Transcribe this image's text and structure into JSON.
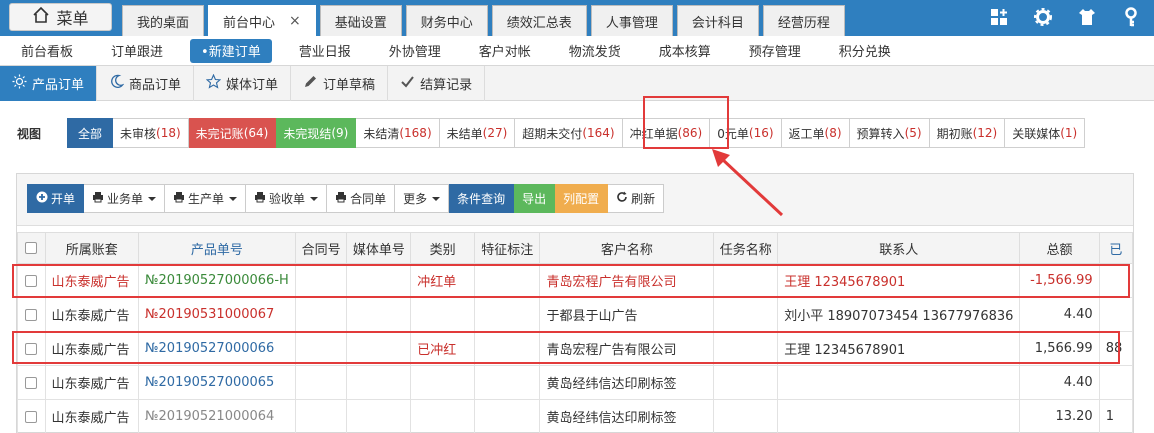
{
  "topbar": {
    "menu_label": "菜单",
    "tabs": [
      {
        "label": "我的桌面"
      },
      {
        "label": "前台中心",
        "close": "×"
      },
      {
        "label": "基础设置"
      },
      {
        "label": "财务中心"
      },
      {
        "label": "绩效汇总表"
      },
      {
        "label": "人事管理"
      },
      {
        "label": "会计科目"
      },
      {
        "label": "经营历程"
      }
    ]
  },
  "subnav": [
    "前台看板",
    "订单跟进",
    "•新建订单",
    "营业日报",
    "外协管理",
    "客户对帐",
    "物流发货",
    "成本核算",
    "预存管理",
    "积分兑换"
  ],
  "order_tabs": [
    "产品订单",
    "商品订单",
    "媒体订单",
    "订单草稿",
    "结算记录"
  ],
  "view": {
    "label": "视图",
    "filters": [
      {
        "label": "全部",
        "count": ""
      },
      {
        "label": "未审核",
        "count": "(18)"
      },
      {
        "label": "未完记账",
        "count": "(64)"
      },
      {
        "label": "未完现结",
        "count": "(9)"
      },
      {
        "label": "未结清",
        "count": "(168)"
      },
      {
        "label": "未结单",
        "count": "(27)"
      },
      {
        "label": "超期未交付",
        "count": "(164)"
      },
      {
        "label": "冲红单据",
        "count": "(86)"
      },
      {
        "label": "0元单",
        "count": "(16)"
      },
      {
        "label": "返工单",
        "count": "(8)"
      },
      {
        "label": "预算转入",
        "count": "(5)"
      },
      {
        "label": "期初账",
        "count": "(12)"
      },
      {
        "label": "关联媒体",
        "count": "(1)"
      }
    ]
  },
  "toolbar": {
    "open": "开单",
    "business": "业务单",
    "production": "生产单",
    "acceptance": "验收单",
    "contract": "合同单",
    "more": "更多",
    "query": "条件查询",
    "export": "导出",
    "columns": "列配置",
    "refresh": "刷新"
  },
  "table": {
    "headers": [
      "所属账套",
      "产品单号",
      "合同号",
      "媒体单号",
      "类别",
      "特征标注",
      "客户名称",
      "任务名称",
      "联系人",
      "总额",
      "已"
    ],
    "rows": [
      {
        "account": "山东泰威广告",
        "order_no": "№20190527000066-H",
        "contract": "",
        "media": "",
        "category": "冲红单",
        "feature": "",
        "customer": "青岛宏程广告有限公司",
        "task": "",
        "contact": "王理 12345678901",
        "total": "-1,566.99",
        "extra": ""
      },
      {
        "account": "山东泰威广告",
        "order_no": "№20190531000067",
        "contract": "",
        "media": "",
        "category": "",
        "feature": "",
        "customer": "于都县于山广告",
        "task": "",
        "contact": "刘小平 18907073454 13677976836",
        "total": "4.40",
        "extra": ""
      },
      {
        "account": "山东泰威广告",
        "order_no": "№20190527000066",
        "contract": "",
        "media": "",
        "category": "已冲红",
        "feature": "",
        "customer": "青岛宏程广告有限公司",
        "task": "",
        "contact": "王理 12345678901",
        "total": "1,566.99",
        "extra": "88"
      },
      {
        "account": "山东泰威广告",
        "order_no": "№20190527000065",
        "contract": "",
        "media": "",
        "category": "",
        "feature": "",
        "customer": "黄岛经纬信达印刷标签",
        "task": "",
        "contact": "",
        "total": "4.40",
        "extra": ""
      },
      {
        "account": "山东泰威广告",
        "order_no": "№20190521000064",
        "contract": "",
        "media": "",
        "category": "",
        "feature": "",
        "customer": "黄岛经纬信达印刷标签",
        "task": "",
        "contact": "",
        "total": "13.20",
        "extra": "1"
      }
    ]
  },
  "colors": {
    "primary": "#2f7fbf",
    "danger": "#d9534f",
    "success": "#5cb85c",
    "warning": "#f0ad4e",
    "annotation": "#e23a3a"
  }
}
